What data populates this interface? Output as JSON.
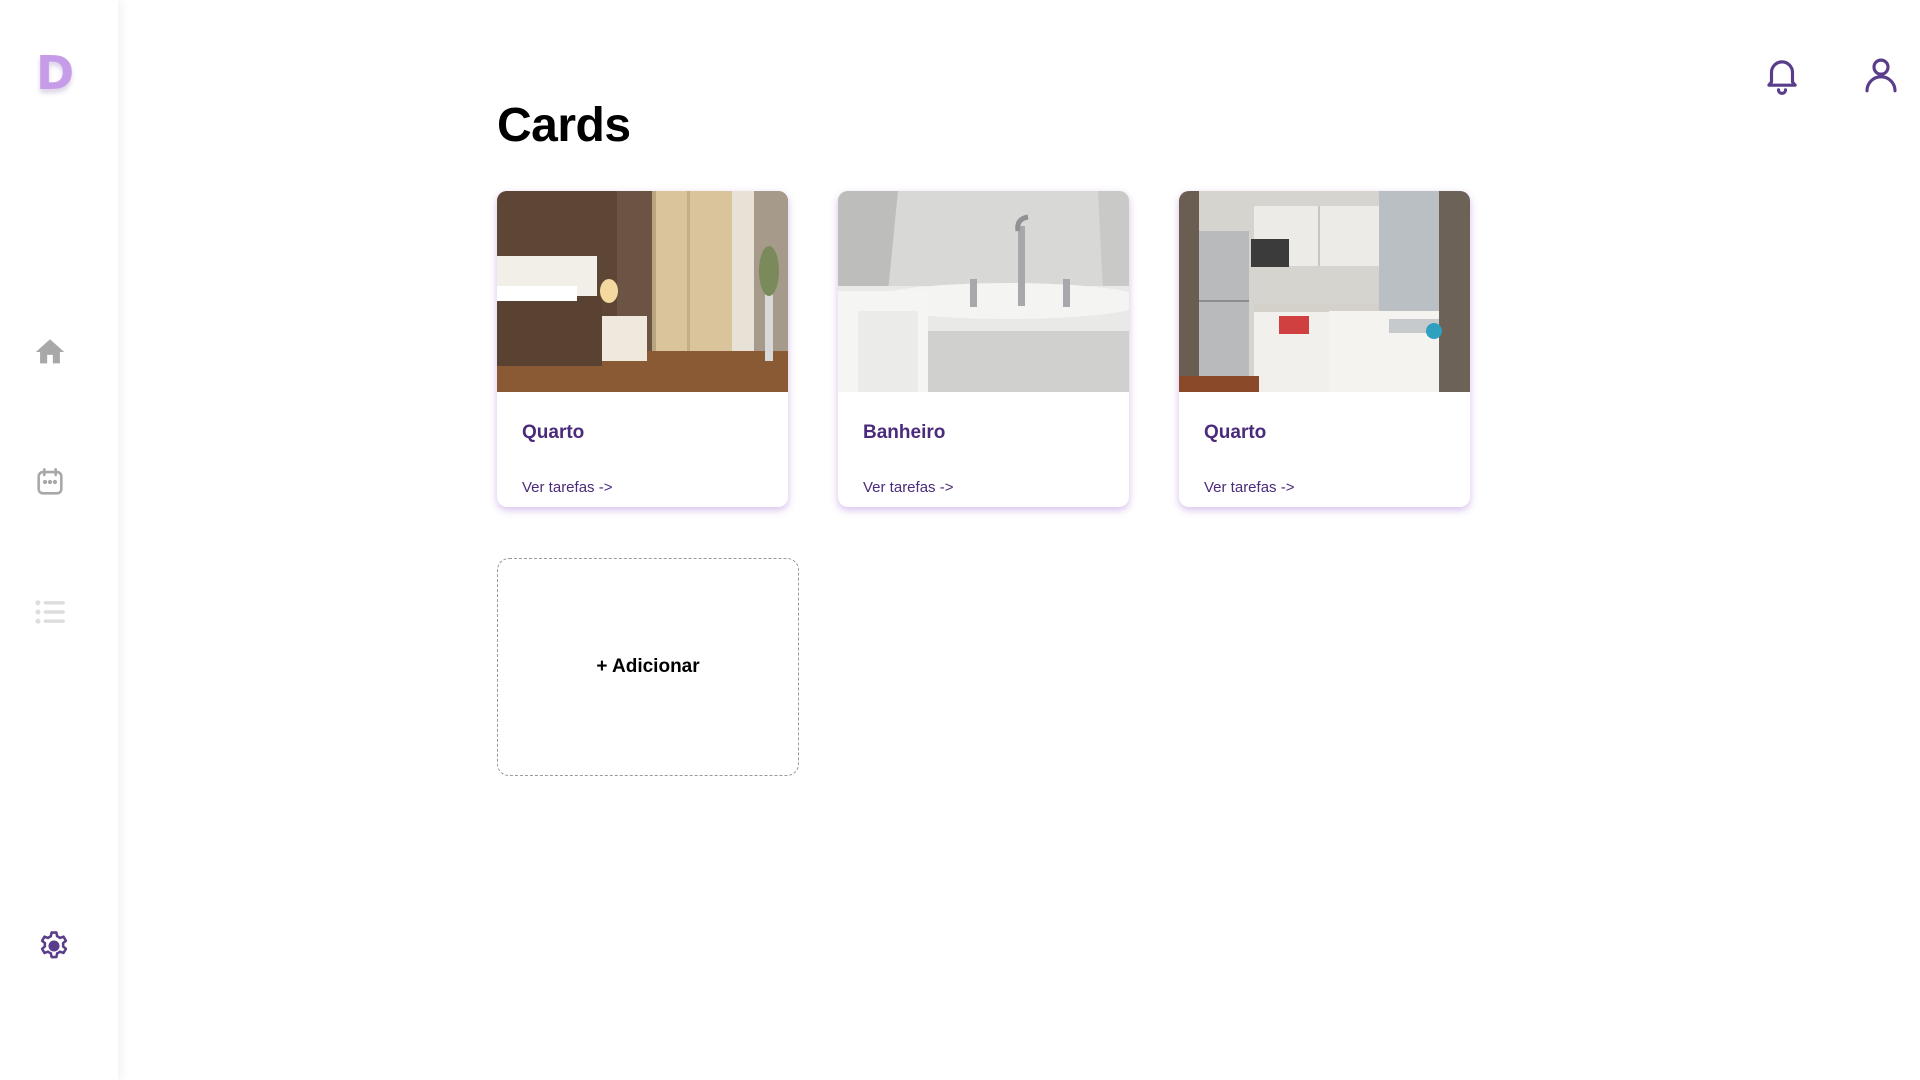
{
  "sidebar": {
    "logo": "D",
    "icons": {
      "home": "home-icon",
      "calendar": "calendar-icon",
      "list": "list-icon",
      "settings": "gear-icon"
    }
  },
  "header": {
    "icons": {
      "notifications": "bell-icon",
      "profile": "user-icon"
    }
  },
  "main": {
    "title": "Cards",
    "cards": [
      {
        "title": "Quarto",
        "link": "Ver tarefas ->",
        "image": "bedroom-photo"
      },
      {
        "title": "Banheiro",
        "link": "Ver tarefas ->",
        "image": "bathroom-photo"
      },
      {
        "title": "Quarto",
        "link": "Ver tarefas ->",
        "image": "kitchen-photo"
      }
    ],
    "add_label": "+ Adicionar"
  },
  "colors": {
    "accent": "#4a2a7a",
    "logo": "#c69be8",
    "nav_inactive": "#a8a8a8",
    "card_shadow": "#a46ed2"
  }
}
